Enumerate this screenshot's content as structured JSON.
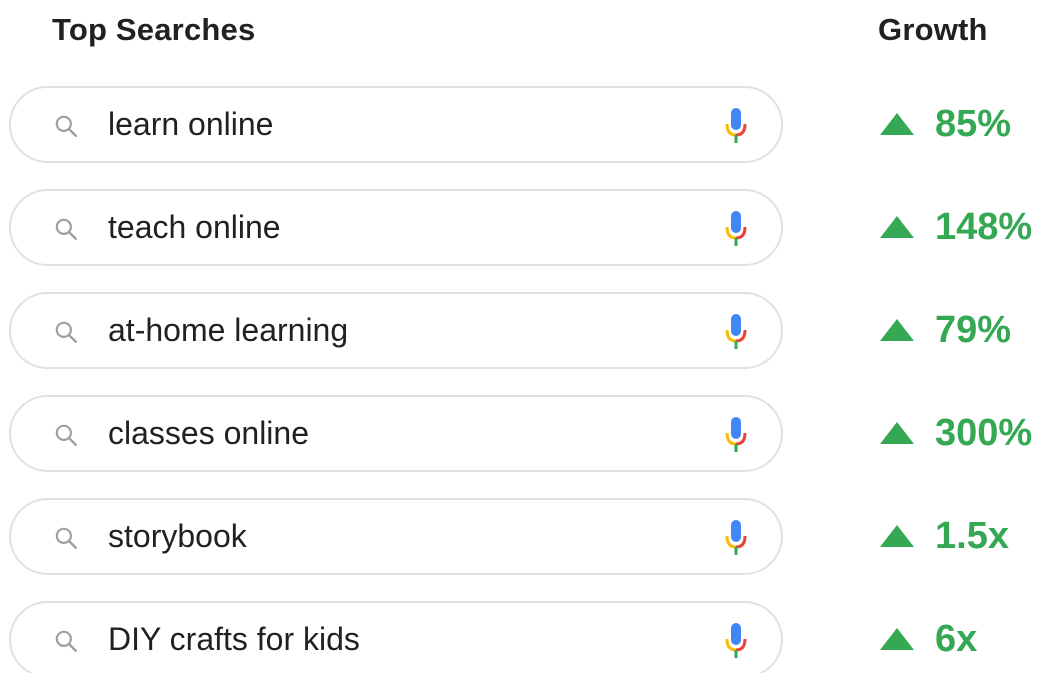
{
  "header": {
    "left_title": "Top Searches",
    "right_title": "Growth"
  },
  "colors": {
    "growth_green": "#34a853",
    "search_border": "#dfe1e5",
    "text": "#202124",
    "mic_blue": "#4285f4",
    "mic_red": "#ea4335",
    "mic_yellow": "#fbbc05",
    "mic_green": "#34a853"
  },
  "icons": {
    "search": "search-icon",
    "mic": "mic-icon",
    "growth": "triangle-up-icon"
  },
  "rows": [
    {
      "query": "learn online",
      "growth": "85%"
    },
    {
      "query": "teach online",
      "growth": "148%"
    },
    {
      "query": "at-home learning",
      "growth": "79%"
    },
    {
      "query": "classes online",
      "growth": "300%"
    },
    {
      "query": "storybook",
      "growth": "1.5x"
    },
    {
      "query": "DIY crafts for kids",
      "growth": "6x"
    }
  ]
}
